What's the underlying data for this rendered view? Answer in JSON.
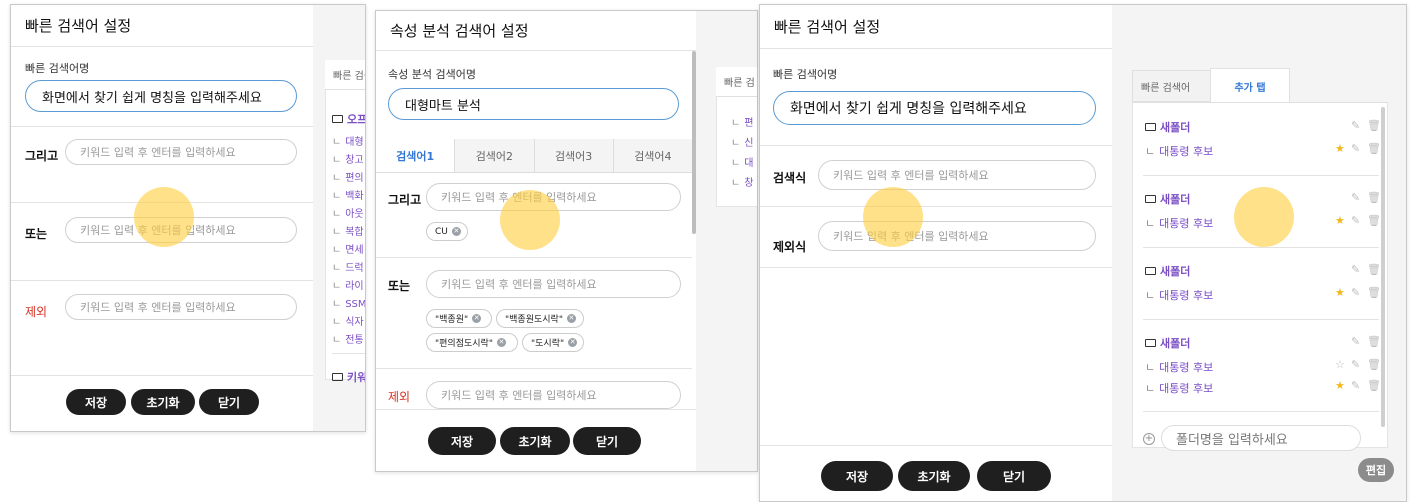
{
  "dialog1": {
    "title": "빠른 검색어 설정",
    "name_label": "빠른 검색어명",
    "name_value": "화면에서 찾기 쉽게 명칭을 입력해주세요",
    "rows": [
      {
        "label": "그리고",
        "placeholder": "키워드 입력 후 엔터를 입력하세요"
      },
      {
        "label": "또는",
        "placeholder": "키워드 입력 후 엔터를 입력하세요"
      },
      {
        "label": "제외",
        "placeholder": "키워드 입력 후 엔터를 입력하세요"
      }
    ],
    "buttons": {
      "save": "저장",
      "reset": "초기화",
      "close": "닫기"
    },
    "side_tab": "빠른 검색",
    "tree": [
      "오프",
      "대형",
      "창고",
      "편의",
      "백화",
      "아웃",
      "복합",
      "면세",
      "드럭",
      "라이",
      "SSM",
      "식자",
      "전통"
    ],
    "tree_bottom": "키워"
  },
  "dialog2": {
    "title": "속성 분석 검색어 설정",
    "name_label": "속성 분석 검색어명",
    "name_value": "대형마트 분석",
    "tabs": [
      "검색어1",
      "검색어2",
      "검색어3",
      "검색어4"
    ],
    "and_label": "그리고",
    "and_placeholder": "키워드 입력 후 엔터를 입력하세요",
    "and_chips": [
      "CU"
    ],
    "or_label": "또는",
    "or_placeholder": "키워드 입력 후 엔터를 입력하세요",
    "or_chips": [
      "\"백종원\"",
      "\"백종원도시락\"",
      "\"편의점도시락\"",
      "\"도시락\""
    ],
    "not_label": "제외",
    "not_placeholder": "키워드 입력 후 엔터를 입력하세요",
    "buttons": {
      "save": "저장",
      "reset": "초기화",
      "close": "닫기"
    },
    "side_tab": "빠른 검",
    "tree": [
      "편",
      "신",
      "대",
      "창"
    ]
  },
  "dialog3": {
    "title": "빠른 검색어 설정",
    "name_label": "빠른 검색어명",
    "name_value": "화면에서 찾기 쉽게 명칭을 입력해주세요",
    "search_label": "검색식",
    "search_placeholder": "키워드 입력 후 엔터를 입력하세요",
    "exclude_label": "제외식",
    "exclude_placeholder": "키워드 입력 후 엔터를 입력하세요",
    "buttons": {
      "save": "저장",
      "reset": "초기화",
      "close": "닫기"
    },
    "help_icon": "?",
    "close_icon": "×",
    "side_tabs": [
      "빠른 검색어",
      "추가 탭"
    ],
    "groups": [
      {
        "folder": "새폴더",
        "items": [
          {
            "label": "대통령 후보",
            "starred": true
          }
        ]
      },
      {
        "folder": "새폴더",
        "items": [
          {
            "label": "대통령 후보",
            "starred": true
          }
        ]
      },
      {
        "folder": "새폴더",
        "items": [
          {
            "label": "대통령 후보",
            "starred": true
          }
        ]
      },
      {
        "folder": "새폴더",
        "items": [
          {
            "label": "대통령 후보",
            "starred": false
          },
          {
            "label": "대통령 후보",
            "starred": true
          }
        ]
      }
    ],
    "folder_placeholder": "폴더명을 입력하세요",
    "edit_button": "편집"
  },
  "colors": {
    "accent": "#3478d4",
    "folder_text": "#7a4ec4",
    "danger": "#d93025",
    "button_dark": "#1f1f1f",
    "star": "#f2b81c",
    "touch": "#ffcf40"
  }
}
